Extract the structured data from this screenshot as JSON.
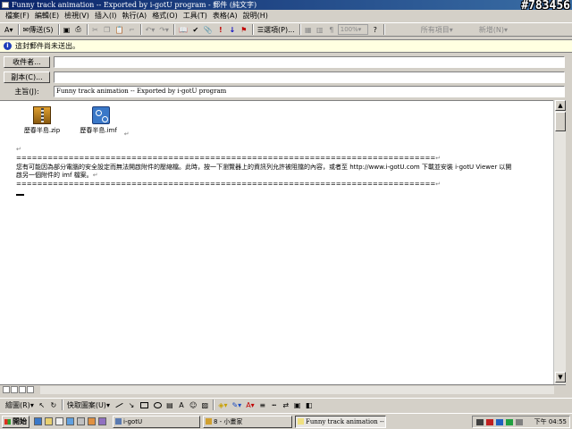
{
  "window": {
    "title": "Funny track animation -- Exported by i-gotU program - 郵件 (純文字)"
  },
  "watermark": "#783456",
  "menu": [
    "檔案(F)",
    "編輯(E)",
    "檢視(V)",
    "插入(I)",
    "執行(A)",
    "格式(O)",
    "工具(T)",
    "表格(A)",
    "說明(H)"
  ],
  "toolbar": {
    "send_label": "傳送(S)",
    "options_label": "選項(P)...",
    "zoom_value": "100%",
    "all_items_label": "所有項目",
    "new_label": "新增(N)"
  },
  "infobar": {
    "text": "這封郵件尚未送出。"
  },
  "header": {
    "to_label": "收件者...",
    "to_value": "",
    "cc_label": "副本(C)...",
    "cc_value": "",
    "subject_label": "主旨(J):",
    "subject_value": "Funny track animation -- Exported by i-gotU program"
  },
  "attachments": [
    {
      "name": "歷春半島.zip",
      "icon": "zip-file-icon"
    },
    {
      "name": "歷春半島.imf",
      "icon": "imf-file-icon"
    }
  ],
  "body": {
    "separator": "================================================================================",
    "line1": "您有可能因為部分電腦的安全設定而無法開啟附件的壓縮檔。此時，按一下瀏覽器上的資訊列允許被阻擋的內容，或者至  http://www.i-gotU.com  下載並安裝  i-gotU Viewer  以開",
    "line2": "啟另一個附件的  imf  檔案。"
  },
  "drawbar": {
    "draw_label": "繪圖(R)",
    "autoshapes_label": "快取圖案(U)"
  },
  "taskbar": {
    "start_label": "開始",
    "tasks": [
      "i-gotU",
      "8 - 小畫家",
      "Funny track animation -- E..."
    ],
    "clock": "下午 04:55"
  }
}
